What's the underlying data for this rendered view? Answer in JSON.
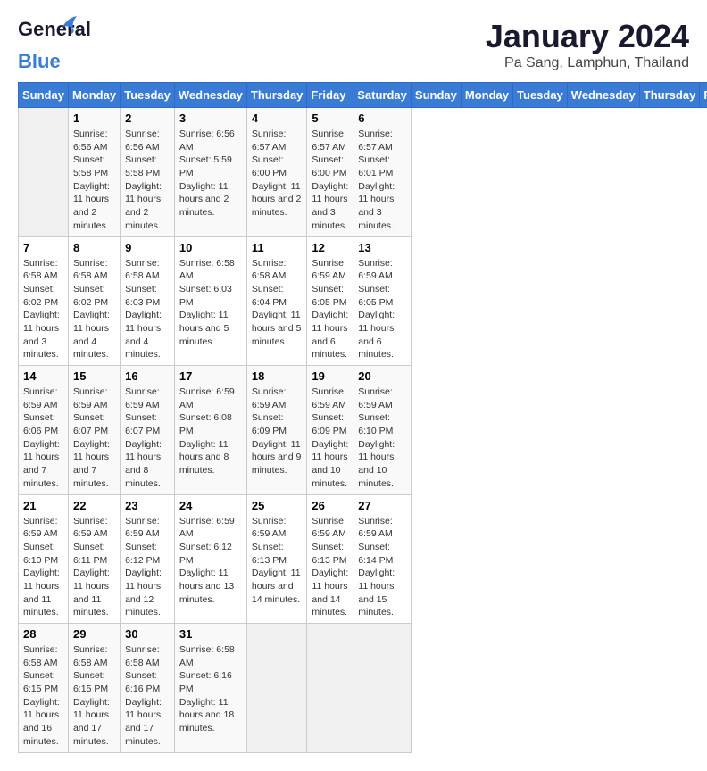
{
  "header": {
    "logo_general": "General",
    "logo_blue": "Blue",
    "month": "January 2024",
    "location": "Pa Sang, Lamphun, Thailand"
  },
  "days_of_week": [
    "Sunday",
    "Monday",
    "Tuesday",
    "Wednesday",
    "Thursday",
    "Friday",
    "Saturday"
  ],
  "weeks": [
    [
      {
        "day": "",
        "sunrise": "",
        "sunset": "",
        "daylight": ""
      },
      {
        "day": "1",
        "sunrise": "Sunrise: 6:56 AM",
        "sunset": "Sunset: 5:58 PM",
        "daylight": "Daylight: 11 hours and 2 minutes."
      },
      {
        "day": "2",
        "sunrise": "Sunrise: 6:56 AM",
        "sunset": "Sunset: 5:58 PM",
        "daylight": "Daylight: 11 hours and 2 minutes."
      },
      {
        "day": "3",
        "sunrise": "Sunrise: 6:56 AM",
        "sunset": "Sunset: 5:59 PM",
        "daylight": "Daylight: 11 hours and 2 minutes."
      },
      {
        "day": "4",
        "sunrise": "Sunrise: 6:57 AM",
        "sunset": "Sunset: 6:00 PM",
        "daylight": "Daylight: 11 hours and 2 minutes."
      },
      {
        "day": "5",
        "sunrise": "Sunrise: 6:57 AM",
        "sunset": "Sunset: 6:00 PM",
        "daylight": "Daylight: 11 hours and 3 minutes."
      },
      {
        "day": "6",
        "sunrise": "Sunrise: 6:57 AM",
        "sunset": "Sunset: 6:01 PM",
        "daylight": "Daylight: 11 hours and 3 minutes."
      }
    ],
    [
      {
        "day": "7",
        "sunrise": "Sunrise: 6:58 AM",
        "sunset": "Sunset: 6:02 PM",
        "daylight": "Daylight: 11 hours and 3 minutes."
      },
      {
        "day": "8",
        "sunrise": "Sunrise: 6:58 AM",
        "sunset": "Sunset: 6:02 PM",
        "daylight": "Daylight: 11 hours and 4 minutes."
      },
      {
        "day": "9",
        "sunrise": "Sunrise: 6:58 AM",
        "sunset": "Sunset: 6:03 PM",
        "daylight": "Daylight: 11 hours and 4 minutes."
      },
      {
        "day": "10",
        "sunrise": "Sunrise: 6:58 AM",
        "sunset": "Sunset: 6:03 PM",
        "daylight": "Daylight: 11 hours and 5 minutes."
      },
      {
        "day": "11",
        "sunrise": "Sunrise: 6:58 AM",
        "sunset": "Sunset: 6:04 PM",
        "daylight": "Daylight: 11 hours and 5 minutes."
      },
      {
        "day": "12",
        "sunrise": "Sunrise: 6:59 AM",
        "sunset": "Sunset: 6:05 PM",
        "daylight": "Daylight: 11 hours and 6 minutes."
      },
      {
        "day": "13",
        "sunrise": "Sunrise: 6:59 AM",
        "sunset": "Sunset: 6:05 PM",
        "daylight": "Daylight: 11 hours and 6 minutes."
      }
    ],
    [
      {
        "day": "14",
        "sunrise": "Sunrise: 6:59 AM",
        "sunset": "Sunset: 6:06 PM",
        "daylight": "Daylight: 11 hours and 7 minutes."
      },
      {
        "day": "15",
        "sunrise": "Sunrise: 6:59 AM",
        "sunset": "Sunset: 6:07 PM",
        "daylight": "Daylight: 11 hours and 7 minutes."
      },
      {
        "day": "16",
        "sunrise": "Sunrise: 6:59 AM",
        "sunset": "Sunset: 6:07 PM",
        "daylight": "Daylight: 11 hours and 8 minutes."
      },
      {
        "day": "17",
        "sunrise": "Sunrise: 6:59 AM",
        "sunset": "Sunset: 6:08 PM",
        "daylight": "Daylight: 11 hours and 8 minutes."
      },
      {
        "day": "18",
        "sunrise": "Sunrise: 6:59 AM",
        "sunset": "Sunset: 6:09 PM",
        "daylight": "Daylight: 11 hours and 9 minutes."
      },
      {
        "day": "19",
        "sunrise": "Sunrise: 6:59 AM",
        "sunset": "Sunset: 6:09 PM",
        "daylight": "Daylight: 11 hours and 10 minutes."
      },
      {
        "day": "20",
        "sunrise": "Sunrise: 6:59 AM",
        "sunset": "Sunset: 6:10 PM",
        "daylight": "Daylight: 11 hours and 10 minutes."
      }
    ],
    [
      {
        "day": "21",
        "sunrise": "Sunrise: 6:59 AM",
        "sunset": "Sunset: 6:10 PM",
        "daylight": "Daylight: 11 hours and 11 minutes."
      },
      {
        "day": "22",
        "sunrise": "Sunrise: 6:59 AM",
        "sunset": "Sunset: 6:11 PM",
        "daylight": "Daylight: 11 hours and 11 minutes."
      },
      {
        "day": "23",
        "sunrise": "Sunrise: 6:59 AM",
        "sunset": "Sunset: 6:12 PM",
        "daylight": "Daylight: 11 hours and 12 minutes."
      },
      {
        "day": "24",
        "sunrise": "Sunrise: 6:59 AM",
        "sunset": "Sunset: 6:12 PM",
        "daylight": "Daylight: 11 hours and 13 minutes."
      },
      {
        "day": "25",
        "sunrise": "Sunrise: 6:59 AM",
        "sunset": "Sunset: 6:13 PM",
        "daylight": "Daylight: 11 hours and 14 minutes."
      },
      {
        "day": "26",
        "sunrise": "Sunrise: 6:59 AM",
        "sunset": "Sunset: 6:13 PM",
        "daylight": "Daylight: 11 hours and 14 minutes."
      },
      {
        "day": "27",
        "sunrise": "Sunrise: 6:59 AM",
        "sunset": "Sunset: 6:14 PM",
        "daylight": "Daylight: 11 hours and 15 minutes."
      }
    ],
    [
      {
        "day": "28",
        "sunrise": "Sunrise: 6:58 AM",
        "sunset": "Sunset: 6:15 PM",
        "daylight": "Daylight: 11 hours and 16 minutes."
      },
      {
        "day": "29",
        "sunrise": "Sunrise: 6:58 AM",
        "sunset": "Sunset: 6:15 PM",
        "daylight": "Daylight: 11 hours and 17 minutes."
      },
      {
        "day": "30",
        "sunrise": "Sunrise: 6:58 AM",
        "sunset": "Sunset: 6:16 PM",
        "daylight": "Daylight: 11 hours and 17 minutes."
      },
      {
        "day": "31",
        "sunrise": "Sunrise: 6:58 AM",
        "sunset": "Sunset: 6:16 PM",
        "daylight": "Daylight: 11 hours and 18 minutes."
      },
      {
        "day": "",
        "sunrise": "",
        "sunset": "",
        "daylight": ""
      },
      {
        "day": "",
        "sunrise": "",
        "sunset": "",
        "daylight": ""
      },
      {
        "day": "",
        "sunrise": "",
        "sunset": "",
        "daylight": ""
      }
    ]
  ]
}
